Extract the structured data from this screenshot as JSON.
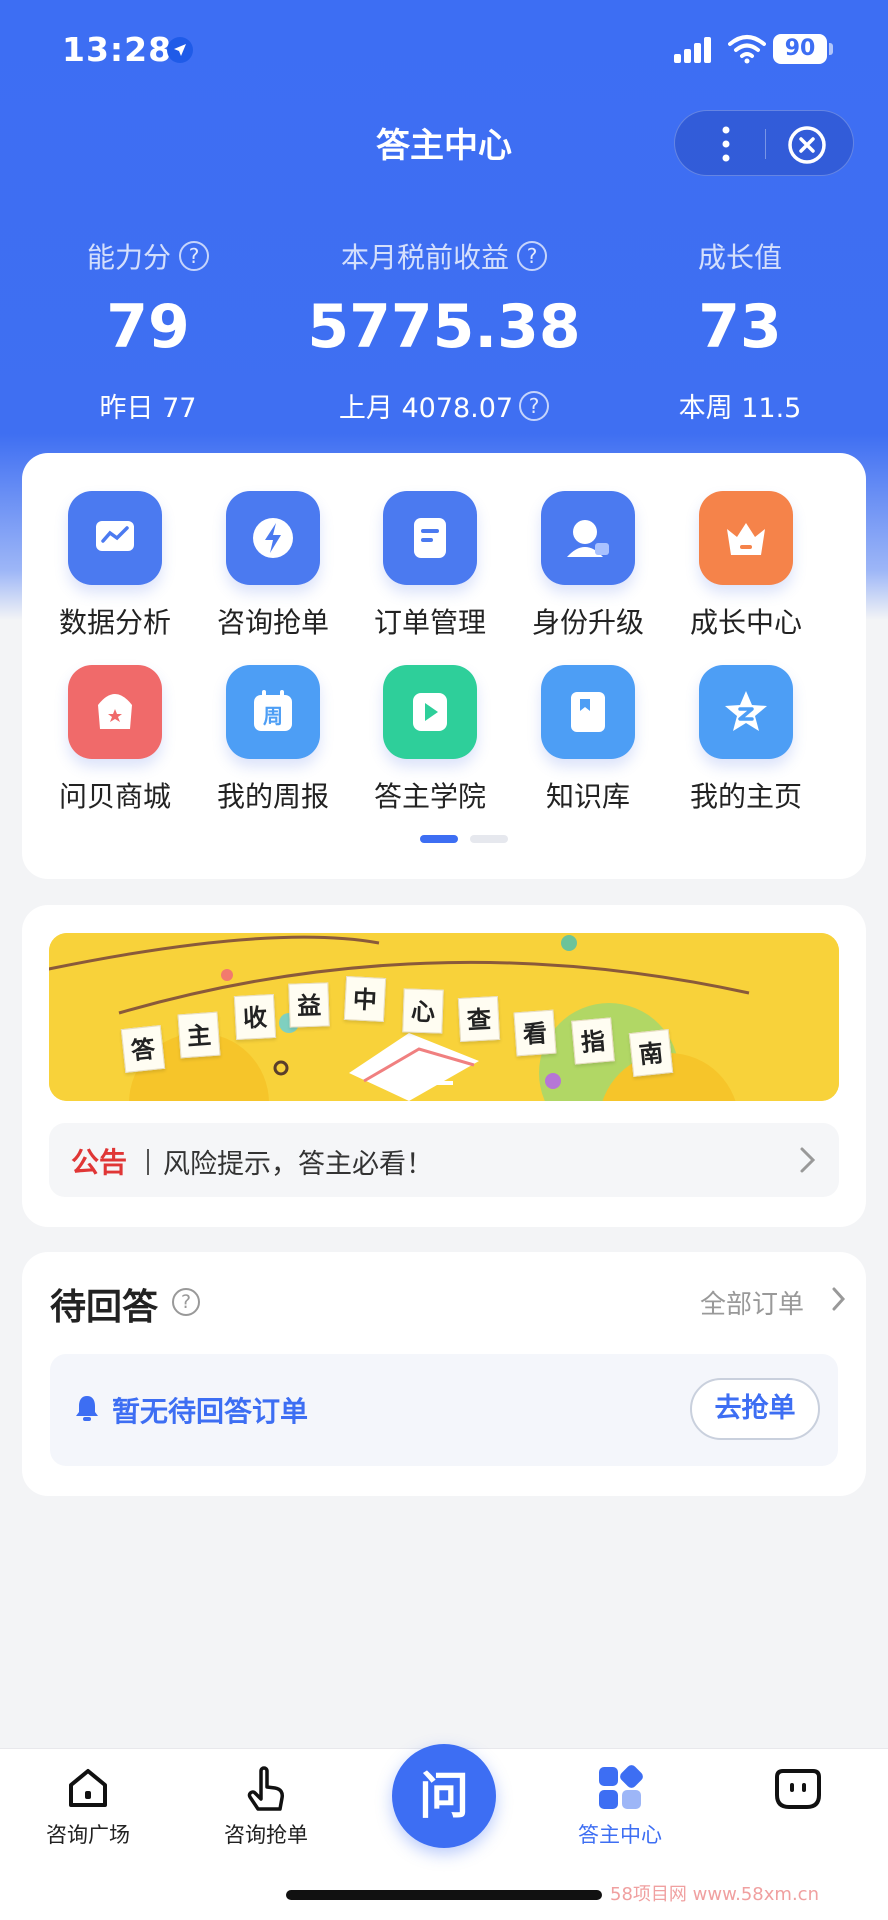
{
  "status_bar": {
    "time": "13:28",
    "battery": "90"
  },
  "header": {
    "title": "答主中心"
  },
  "stats": [
    {
      "label": "能力分",
      "value": "79",
      "sub": "昨日 77"
    },
    {
      "label": "本月税前收益",
      "value": "5775.38",
      "sub": "上月 4078.07"
    },
    {
      "label": "成长值",
      "value": "73",
      "sub": "本周 11.5"
    }
  ],
  "menu": {
    "items": [
      {
        "label": "数据分析",
        "icon": "chart-icon",
        "color": "#4b7af0"
      },
      {
        "label": "咨询抢单",
        "icon": "lightning-icon",
        "color": "#4b7af0"
      },
      {
        "label": "订单管理",
        "icon": "document-icon",
        "color": "#4b7af0"
      },
      {
        "label": "身份升级",
        "icon": "user-upgrade-icon",
        "color": "#4b7af0"
      },
      {
        "label": "成长中心",
        "icon": "crown-icon",
        "color": "#f5834a"
      },
      {
        "label": "问贝商城",
        "icon": "shop-icon",
        "color": "#f06a6a"
      },
      {
        "label": "我的周报",
        "icon": "calendar-icon",
        "color": "#4d9ef5",
        "glyph": "周"
      },
      {
        "label": "答主学院",
        "icon": "play-icon",
        "color": "#2ecf9a"
      },
      {
        "label": "知识库",
        "icon": "book-icon",
        "color": "#4d9ef5"
      },
      {
        "label": "我的主页",
        "icon": "star-icon",
        "color": "#4d9ef5"
      }
    ],
    "page_count": 2,
    "current_page": 1
  },
  "banner": {
    "letters": [
      "答",
      "主",
      "收",
      "益",
      "中",
      "心",
      "查",
      "看",
      "指",
      "南"
    ]
  },
  "notice": {
    "tag": "公告",
    "text": "风险提示，答主必看！"
  },
  "pending": {
    "title": "待回答",
    "all_orders": "全部订单",
    "empty_text": "暂无待回答订单",
    "grab_button": "去抢单"
  },
  "tabbar": {
    "tabs": [
      {
        "label": "咨询广场",
        "icon": "home-icon"
      },
      {
        "label": "咨询抢单",
        "icon": "tap-icon"
      },
      {
        "label": "答主中心",
        "icon": "grid-icon",
        "active": true
      },
      {
        "label": "",
        "icon": "face-icon"
      }
    ],
    "center_label": "问"
  },
  "watermark": "58项目网 www.58xm.cn"
}
